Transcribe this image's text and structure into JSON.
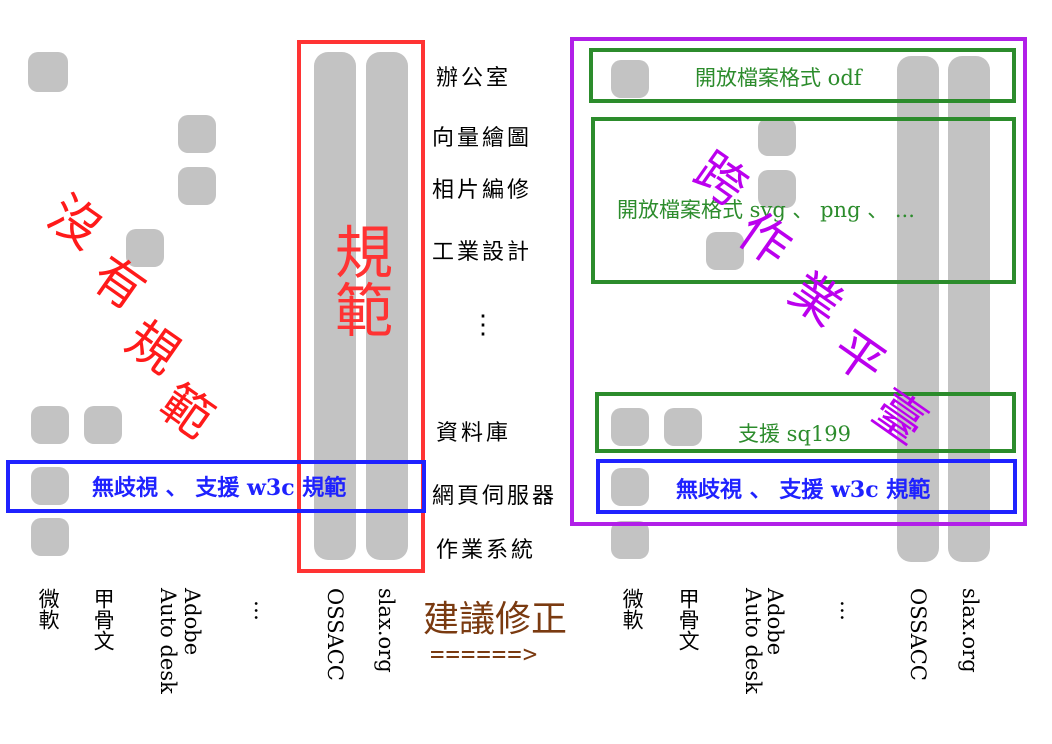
{
  "categories": [
    "辦公室",
    "向量繪圖",
    "相片編修",
    "工業設計",
    "⋮",
    "資料庫",
    "網頁伺服器",
    "作業系統"
  ],
  "left_vendors": [
    "微軟",
    "甲骨文",
    "Auto desk",
    "Adobe",
    "…",
    "OSSACC",
    "slax.org"
  ],
  "right_vendors": [
    "微軟",
    "甲骨文",
    "Auto desk",
    "Adobe",
    "…",
    "OSSACC",
    "slax.org"
  ],
  "left_annotations": {
    "no_standard": [
      "沒",
      "有",
      "規",
      "範"
    ],
    "standard": [
      "規",
      "範"
    ],
    "w3c": "無歧視 、 支援 w3c 規範"
  },
  "right_annotations": {
    "odf": "開放檔案格式 odf",
    "svg": "開放檔案格式 svg 、 png 、 ...",
    "sql": "支援 sq199",
    "w3c": "無歧視 、 支援 w3c 規範",
    "cross_platform": [
      "跨",
      "作",
      "業",
      "平",
      "臺"
    ]
  },
  "center": {
    "suggest": "建議修正",
    "arrow": "======>"
  },
  "colors": {
    "cell": "#c3c3c3",
    "red": "#ff3333",
    "blue": "#1f22ff",
    "green": "#2c8c2c",
    "purple": "#b11fe8",
    "violet_text": "#bb00ee",
    "brown": "#7a3a10"
  }
}
